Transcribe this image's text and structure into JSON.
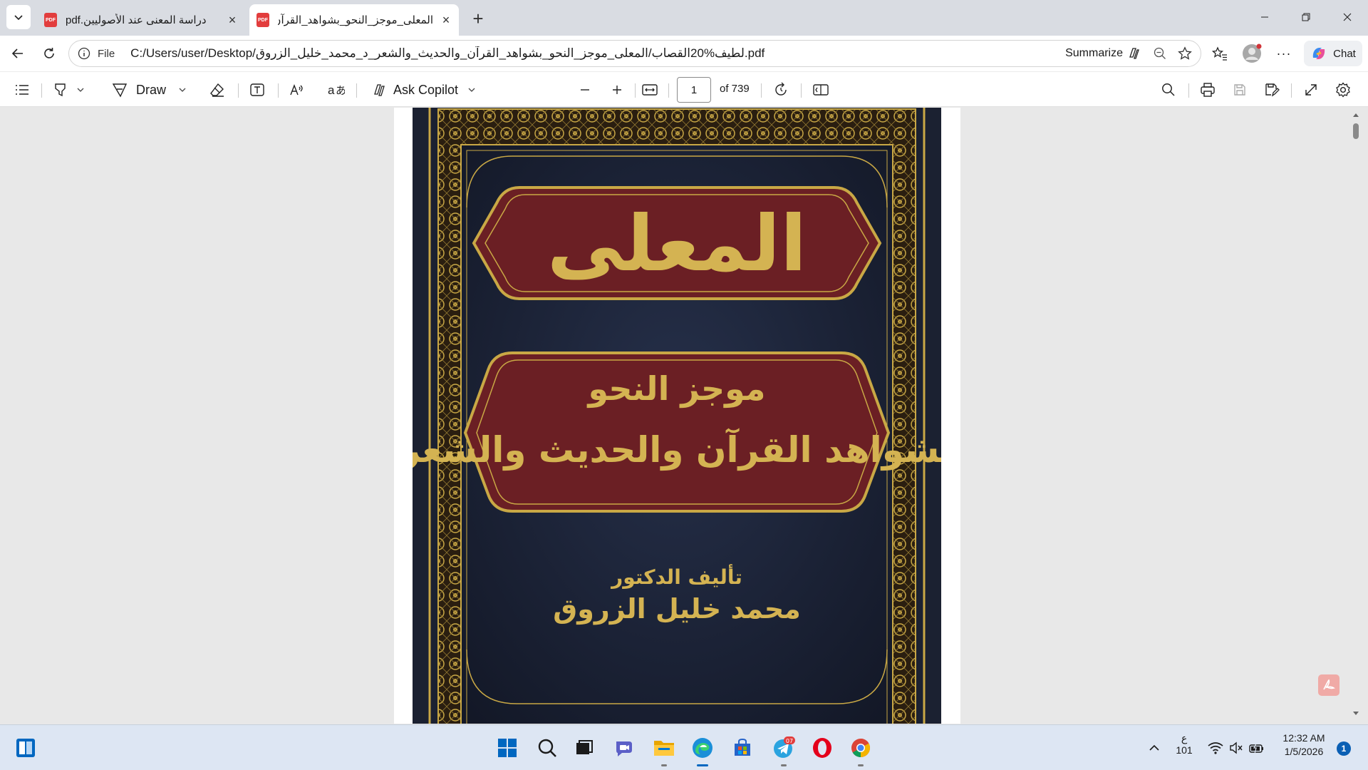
{
  "tabs": [
    {
      "title": "دراسة المعنى عند الأصوليين.pdf",
      "icon": "pdf-icon",
      "active": false
    },
    {
      "title": "المعلى_موجز_النحو_بشواهد_القرآن_والحديث_والشعر_د_محمد_خليل_الزروق.pdf",
      "icon": "pdf-icon",
      "active": true
    }
  ],
  "address": {
    "scheme": "File",
    "url": "C:/Users/user/Desktop/لطيف%20القصاب/المعلى_موجز_النحو_بشواهد_القرآن_والحديث_والشعر_د_محمد_خليل_الزروق.pdf",
    "summarize_label": "Summarize",
    "chat_label": "Chat"
  },
  "toolbar": {
    "draw_label": "Draw",
    "copilot_label": "Ask Copilot",
    "page_current": "1",
    "page_total": "of 739"
  },
  "cover": {
    "title": "المعلى",
    "subtitle_line1": "موجز النحو",
    "subtitle_line2": "بشواهد القرآن والحديث والشعر",
    "author_prefix": "تأليف الدكتور",
    "author_name": "محمد خليل الزروق",
    "colors": {
      "background": "#1a2033",
      "gold": "#c9a845",
      "panel": "#6b1f24"
    }
  },
  "taskbar": {
    "keyboard_lang": "ع",
    "keyboard_sub": "101",
    "time": "12:32 AM",
    "date": "1/5/2026",
    "notifications": "1",
    "telegram_badge": "07"
  }
}
